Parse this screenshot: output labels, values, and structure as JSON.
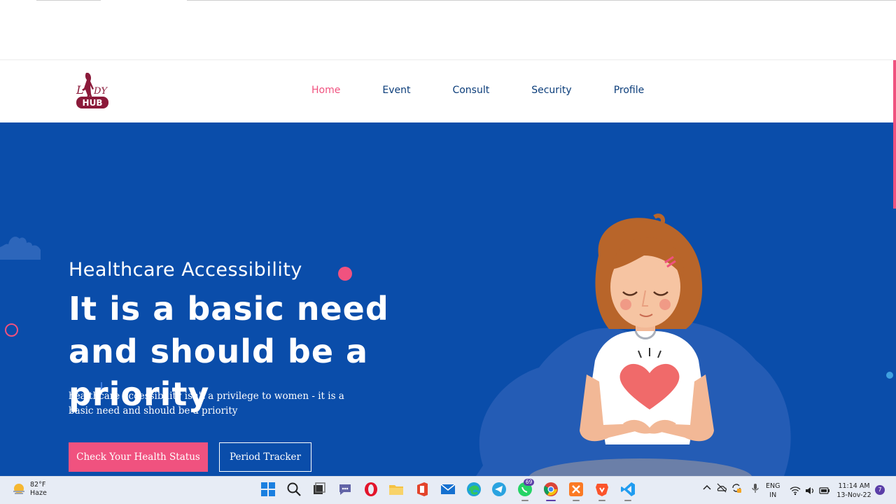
{
  "nav": {
    "items": [
      {
        "label": "Home",
        "active": true
      },
      {
        "label": "Event",
        "active": false
      },
      {
        "label": "Consult",
        "active": false
      },
      {
        "label": "Security",
        "active": false
      },
      {
        "label": "Profile",
        "active": false
      }
    ]
  },
  "hero": {
    "eyebrow": "Healthcare Accessibility",
    "headline": "It is a basic need and should be a priority",
    "subtext": "healthcare accessibility isn't a privilege to women - it is a basic need and should be a priority",
    "primary_button": "Check Your Health Status",
    "secondary_button": "Period Tracker"
  },
  "colors": {
    "brand_blue": "#0a4daa",
    "accent_pink": "#f0527f",
    "nav_text": "#0b3d7a"
  },
  "taskbar": {
    "weather_temp": "82°F",
    "weather_desc": "Haze",
    "whatsapp_badge": "69",
    "lang_line1": "ENG",
    "lang_line2": "IN",
    "time": "11:14 AM",
    "date": "13-Nov-22",
    "notification_count": "7",
    "apps": [
      "windows-start-icon",
      "search-icon",
      "task-view-icon",
      "teams-chat-icon",
      "opera-icon",
      "file-explorer-icon",
      "office-icon",
      "mail-icon",
      "edge-icon",
      "telegram-icon",
      "whatsapp-icon",
      "chrome-icon",
      "xampp-icon",
      "brave-icon",
      "vscode-icon"
    ]
  }
}
